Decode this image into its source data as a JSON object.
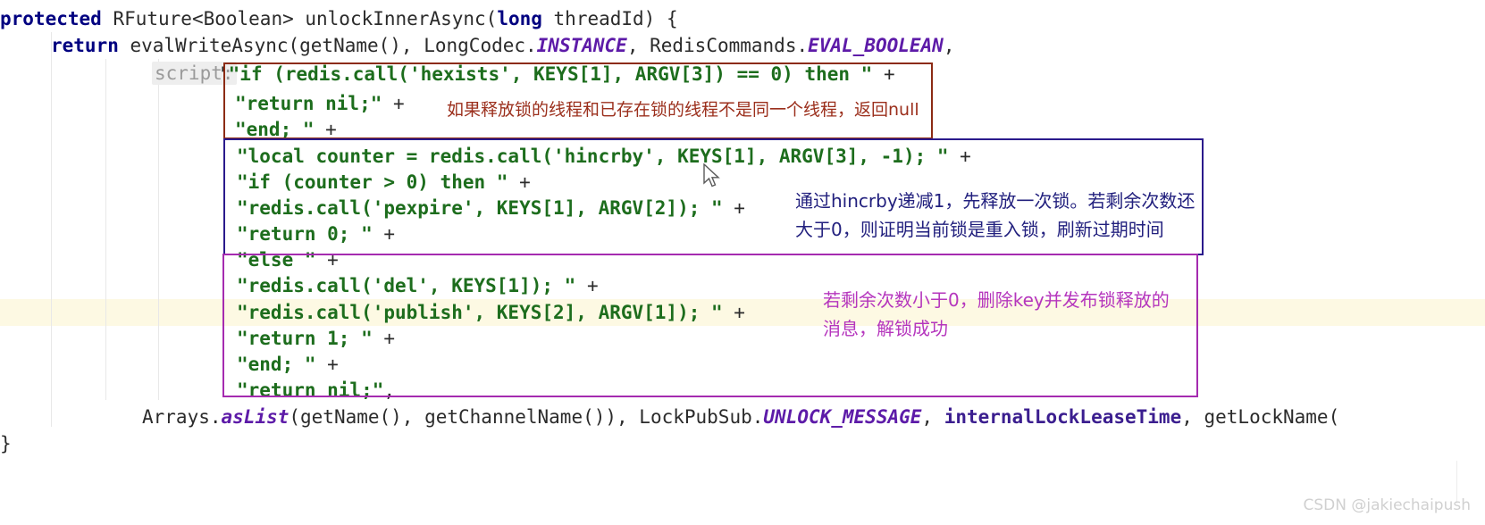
{
  "editor": {
    "language": "java",
    "code_lines": [
      {
        "id": "method-signature",
        "tokens": [
          {
            "text": "protected ",
            "style": "kw"
          },
          {
            "text": "RFuture<Boolean> unlockInnerAsync(",
            "style": "plain"
          },
          {
            "text": "long",
            "style": "kw"
          },
          {
            "text": " threadId) {",
            "style": "plain"
          }
        ]
      },
      {
        "id": "return-evalwriteasync",
        "tokens": [
          {
            "text": "return",
            "style": "kw"
          },
          {
            "text": " evalWriteAsync(getName(), LongCodec.",
            "style": "plain"
          },
          {
            "text": "INSTANCE",
            "style": "static"
          },
          {
            "text": ", RedisCommands.",
            "style": "plain"
          },
          {
            "text": "EVAL_BOOLEAN",
            "style": "static"
          },
          {
            "text": ",",
            "style": "plain"
          }
        ]
      },
      {
        "id": "script-line-1",
        "tokens": [
          {
            "text": "'",
            "style": "plain"
          },
          {
            "text": "\"if (redis.call('hexists', KEYS[1], ARGV[3]) == 0) then \"",
            "style": "str"
          },
          {
            "text": " +",
            "style": "plain"
          }
        ]
      },
      {
        "id": "script-line-2",
        "tokens": [
          {
            "text": "\"return nil;\"",
            "style": "str"
          },
          {
            "text": " +",
            "style": "plain"
          }
        ]
      },
      {
        "id": "script-line-3",
        "tokens": [
          {
            "text": "\"end; \"",
            "style": "str"
          },
          {
            "text": " +",
            "style": "plain"
          }
        ]
      },
      {
        "id": "script-line-4",
        "tokens": [
          {
            "text": "\"local counter = redis.call('hincrby', KEYS[1], ARGV[3], -1); \"",
            "style": "str"
          },
          {
            "text": " +",
            "style": "plain"
          }
        ]
      },
      {
        "id": "script-line-5",
        "tokens": [
          {
            "text": "\"if (counter > 0) then \"",
            "style": "str"
          },
          {
            "text": " +",
            "style": "plain"
          }
        ]
      },
      {
        "id": "script-line-6",
        "tokens": [
          {
            "text": "\"redis.call('pexpire', KEYS[1], ARGV[2]); \"",
            "style": "str"
          },
          {
            "text": " +",
            "style": "plain"
          }
        ]
      },
      {
        "id": "script-line-7",
        "tokens": [
          {
            "text": "\"return 0; \"",
            "style": "str"
          },
          {
            "text": " +",
            "style": "plain"
          }
        ]
      },
      {
        "id": "script-line-8",
        "tokens": [
          {
            "text": "\"else \"",
            "style": "str"
          },
          {
            "text": " +",
            "style": "plain"
          }
        ]
      },
      {
        "id": "script-line-9",
        "tokens": [
          {
            "text": "\"redis.call('del', KEYS[1]); \"",
            "style": "str"
          },
          {
            "text": " +",
            "style": "plain"
          }
        ]
      },
      {
        "id": "script-line-10",
        "tokens": [
          {
            "text": "\"redis.call('publish', KEYS[2], ARGV[1]); \"",
            "style": "str"
          },
          {
            "text": " +",
            "style": "plain"
          }
        ]
      },
      {
        "id": "script-line-11",
        "tokens": [
          {
            "text": "\"return 1; \"",
            "style": "str"
          },
          {
            "text": " +",
            "style": "plain"
          }
        ]
      },
      {
        "id": "script-line-12",
        "tokens": [
          {
            "text": "\"end; \"",
            "style": "str"
          },
          {
            "text": " +",
            "style": "plain"
          }
        ]
      },
      {
        "id": "script-line-13",
        "tokens": [
          {
            "text": "\"return nil;\"",
            "style": "str"
          },
          {
            "text": ",",
            "style": "plain"
          }
        ]
      },
      {
        "id": "arrays-aslist-line",
        "tokens": [
          {
            "text": "Arrays.",
            "style": "plain"
          },
          {
            "text": "asList",
            "style": "static"
          },
          {
            "text": "(getName(), getChannelName()), LockPubSub.",
            "style": "plain"
          },
          {
            "text": "UNLOCK_MESSAGE",
            "style": "static"
          },
          {
            "text": ", ",
            "style": "plain"
          },
          {
            "text": "internalLockLeaseTime",
            "style": "field"
          },
          {
            "text": ", getLockName(",
            "style": "plain"
          }
        ]
      },
      {
        "id": "closing-brace-line",
        "tokens": [
          {
            "text": "}",
            "style": "plain"
          }
        ]
      }
    ],
    "script_label": "script:"
  },
  "annotations": [
    {
      "id": "annotation-red",
      "color": "#8c2b14",
      "text_color": "#9b2f1c",
      "lines": [
        "如果释放锁的线程和已存在锁的线程不是同一个线程，返回null"
      ]
    },
    {
      "id": "annotation-navy",
      "color": "#2a1a8c",
      "text_color": "#22207e",
      "lines": [
        "通过hincrby递减1，先释放一次锁。若剩余次数还",
        "大于0，则证明当前锁是重入锁，刷新过期时间"
      ]
    },
    {
      "id": "annotation-purple",
      "color": "#a52bb0",
      "text_color": "#b536bd",
      "lines": [
        "若剩余次数小于0，删除key并发布锁释放的",
        "消息，解锁成功"
      ]
    }
  ],
  "watermark": {
    "text": "CSDN @jakiechaipush"
  },
  "colors": {
    "keyword": "#000080",
    "string": "#1d6d1d",
    "static_field": "#5d1ba8",
    "instance_field": "#3b1e8f",
    "line_highlight": "#fdf9e3",
    "indent_guide": "#e8e8e8",
    "background": "#ffffff"
  }
}
